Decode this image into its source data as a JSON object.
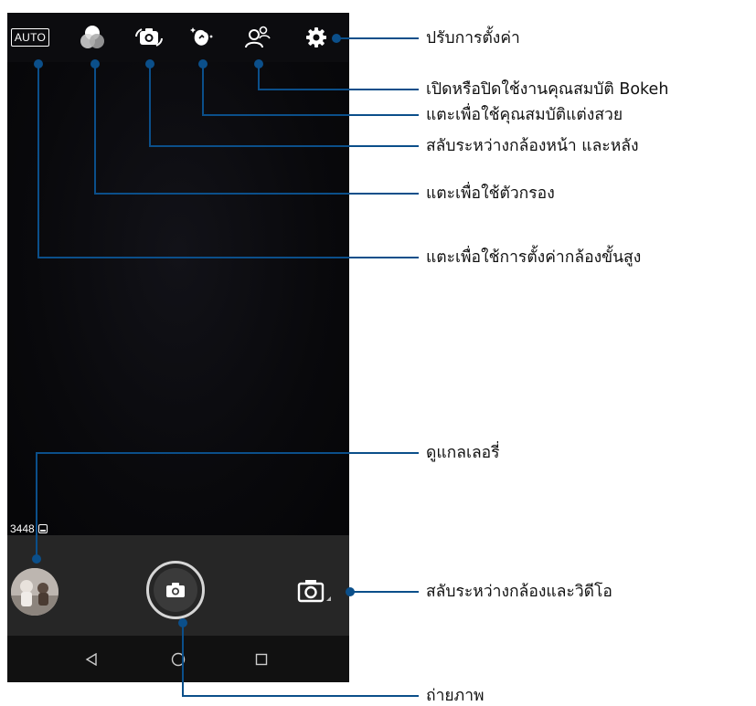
{
  "camera": {
    "mode_badge": "AUTO",
    "photo_counter": "3448",
    "icons": {
      "filter": "filter-icon",
      "switch_camera": "switch-camera-icon",
      "beautify": "beautify-icon",
      "bokeh": "bokeh-icon",
      "settings": "gear-icon",
      "shutter": "camera-icon",
      "switch_video": "camera-video-switch-icon",
      "nav_back": "back-icon",
      "nav_home": "home-icon",
      "nav_recents": "recents-icon"
    }
  },
  "callouts": {
    "settings": "ปรับการตั้งค่า",
    "bokeh": "เปิดหรือปิดใช้งานคุณสมบัติ Bokeh",
    "beautify": "แตะเพื่อใช้คุณสมบัติแต่งสวย",
    "switch_camera": "สลับระหว่างกล้องหน้า และหลัง",
    "filter": "แตะเพื่อใช้ตัวกรอง",
    "advanced": "แตะเพื่อใช้การตั้งค่ากล้องขั้นสูง",
    "gallery": "ดูแกลเลอรี่",
    "switch_video": "สลับระหว่างกล้องและวิดีโอ",
    "capture": "ถ่ายภาพ"
  },
  "colors": {
    "leader_line": "#0b4f8a",
    "screen_bg": "#000000",
    "bottom_bar": "#262626"
  }
}
